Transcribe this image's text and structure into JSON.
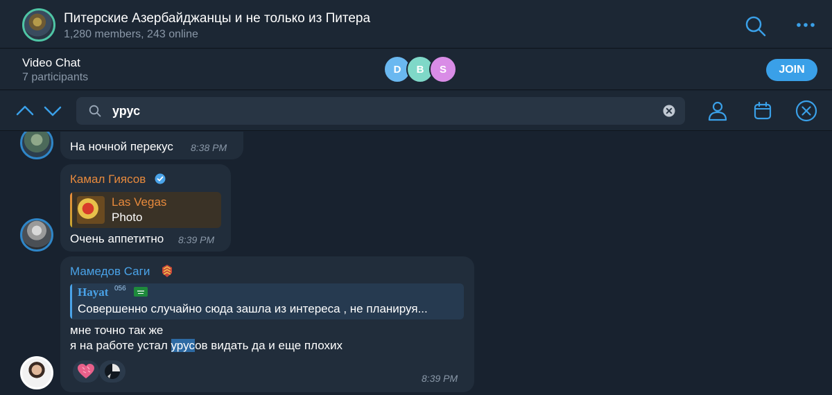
{
  "header": {
    "title": "Питерские Азербайджанцы и не только из Питера",
    "subtitle": "1,280 members, 243 online"
  },
  "video_chat": {
    "title": "Video Chat",
    "participants": "7 participants",
    "avatars": [
      {
        "letter": "D",
        "color": "#6ab8f0"
      },
      {
        "letter": "B",
        "color": "#7fd8c8"
      },
      {
        "letter": "S",
        "color": "#d98ce6"
      }
    ],
    "join_label": "JOIN"
  },
  "search": {
    "query": "урус"
  },
  "messages": [
    {
      "text": "На ночной перекус",
      "time": "8:38 PM"
    },
    {
      "author": "Камал Гиясов",
      "reply_author": "Las Vegas",
      "reply_text": "Photo",
      "text": "Очень аппетитно",
      "time": "8:39 PM"
    },
    {
      "author": "Мамедов Саги",
      "reply_author": "Hayat",
      "reply_author_sup": "056",
      "reply_text": "Совершенно случайно сюда зашла из интереса , не планируя...",
      "line1": "мне точно так же",
      "line2_before": "я на работе устал ",
      "line2_highlight": "урус",
      "line2_after": "ов видать да и еще плохих",
      "time": "8:39 PM"
    }
  ],
  "colors": {
    "accent": "#3aa0e8",
    "orange_author": "#e88a3c",
    "blue_author": "#4aa3e8",
    "highlight": "#2d6aa3"
  }
}
